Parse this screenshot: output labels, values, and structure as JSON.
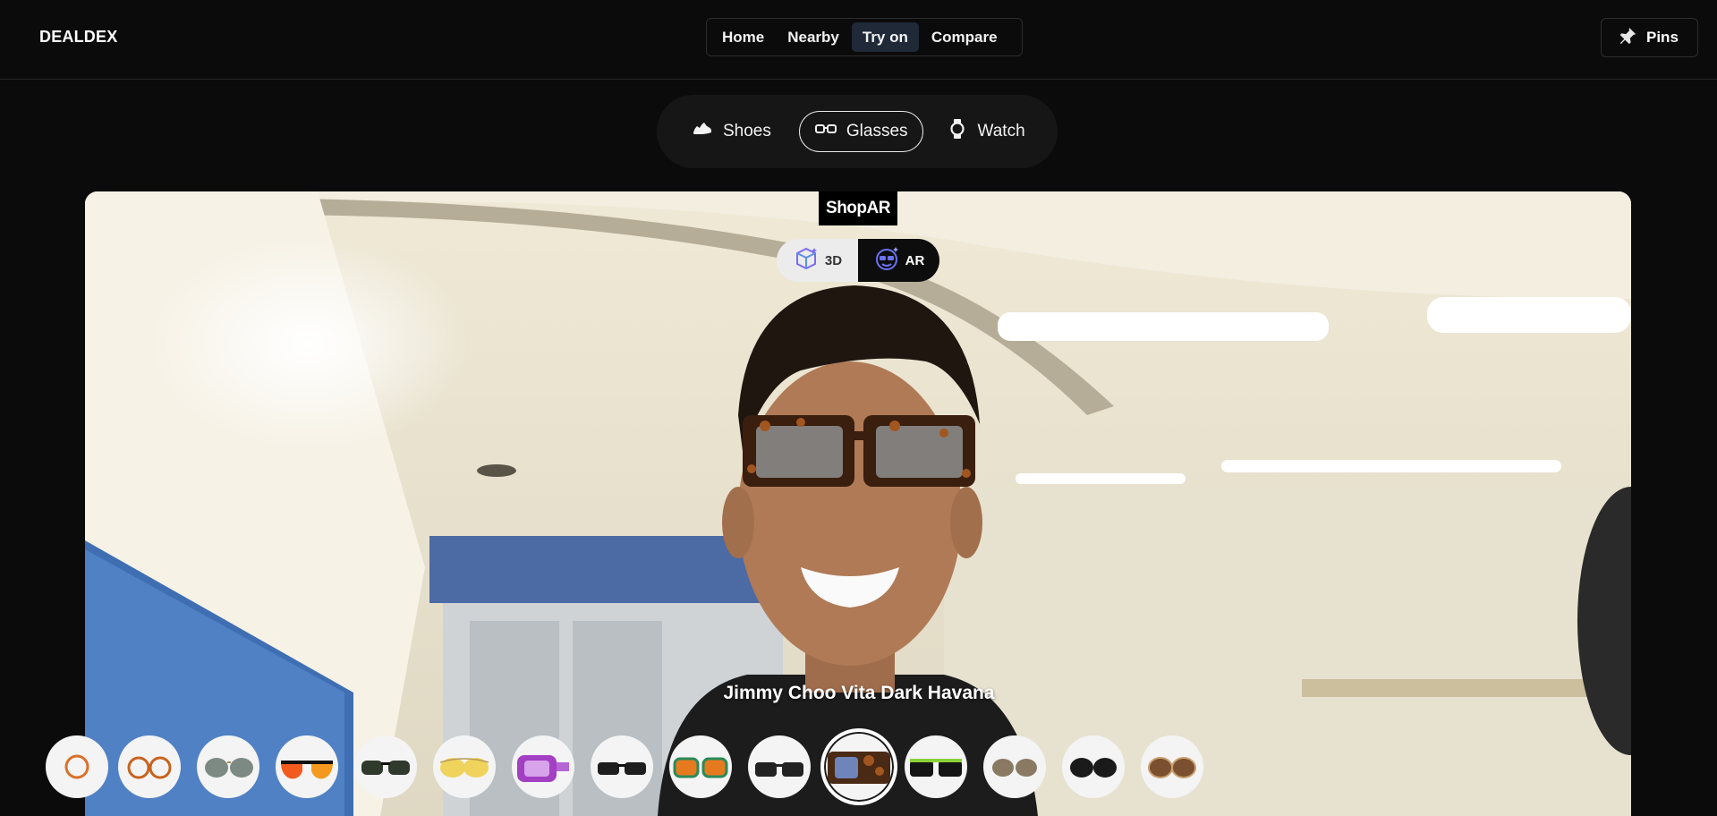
{
  "brand": "DEALDEX",
  "nav": {
    "items": [
      {
        "label": "Home"
      },
      {
        "label": "Nearby"
      },
      {
        "label": "Try on",
        "active": true
      },
      {
        "label": "Compare"
      }
    ],
    "pins_label": "Pins",
    "pins_icon": "pin-icon"
  },
  "categories": [
    {
      "label": "Shoes",
      "icon": "shoe-icon"
    },
    {
      "label": "Glasses",
      "icon": "glasses-icon",
      "active": true
    },
    {
      "label": "Watch",
      "icon": "watch-icon"
    }
  ],
  "viewer": {
    "brand_badge": "ShopAR",
    "modes": [
      {
        "label": "3D",
        "icon": "cube-icon"
      },
      {
        "label": "AR",
        "icon": "ar-face-icon",
        "active": true
      }
    ],
    "product_name": "Jimmy Choo Vita Dark Havana",
    "selected_index": 9
  },
  "colors": {
    "background": "#0b0b0b",
    "nav_active": "#1f2937",
    "tab_border": "#e8e8e8"
  }
}
